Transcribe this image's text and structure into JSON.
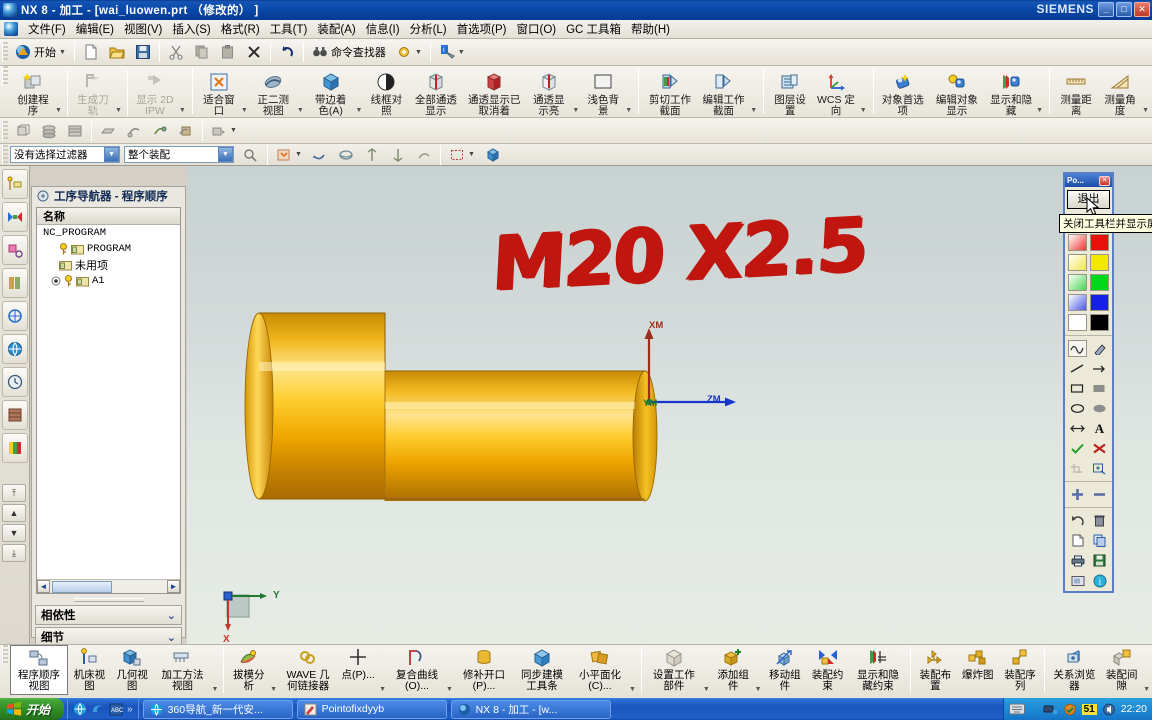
{
  "window": {
    "title": "NX 8 - 加工 - [wai_luowen.prt  （修改的）  ]",
    "brand": "SIEMENS",
    "minimize": "_",
    "maximize": "□",
    "close": "✕"
  },
  "menubar": {
    "items": [
      {
        "label": "文件(F)"
      },
      {
        "label": "编辑(E)"
      },
      {
        "label": "视图(V)"
      },
      {
        "label": "插入(S)"
      },
      {
        "label": "格式(R)"
      },
      {
        "label": "工具(T)"
      },
      {
        "label": "装配(A)"
      },
      {
        "label": "信息(I)"
      },
      {
        "label": "分析(L)"
      },
      {
        "label": "首选项(P)"
      },
      {
        "label": "窗口(O)"
      },
      {
        "label": "GC 工具箱"
      },
      {
        "label": "帮助(H)"
      }
    ],
    "mdi_minimize": "_",
    "mdi_restore": "❐",
    "mdi_close": "✕"
  },
  "standard_toolbar": {
    "start_label": "开始",
    "command_finder_label": "命令查找器",
    "buttons": [
      {
        "name": "new-file",
        "icon": "new-document-icon"
      },
      {
        "name": "open-file",
        "icon": "open-folder-icon"
      },
      {
        "name": "save-file",
        "icon": "save-disk-icon"
      },
      {
        "name": "cut",
        "icon": "scissors-icon"
      },
      {
        "name": "copy",
        "icon": "copy-icon"
      },
      {
        "name": "paste",
        "icon": "paste-icon"
      },
      {
        "name": "delete",
        "icon": "delete-x-icon"
      },
      {
        "name": "undo",
        "icon": "undo-arrow-icon"
      }
    ]
  },
  "ribbon": {
    "groups": [
      {
        "name": "program-group",
        "buttons": [
          {
            "label": "创建程序",
            "icon": "create-program-icon",
            "dim": false,
            "dropdown": true
          },
          {
            "label": "生成刀轨",
            "icon": "generate-toolpath-icon",
            "dim": true,
            "dropdown": true
          },
          {
            "label": "显示 2D IPW",
            "icon": "show-2d-ipw-icon",
            "dim": true,
            "dropdown": true
          }
        ]
      },
      {
        "name": "view-group",
        "buttons": [
          {
            "label": "适合窗口",
            "icon": "fit-window-icon",
            "dim": false,
            "dropdown": true
          },
          {
            "label": "正二测视图",
            "icon": "trimetric-view-icon",
            "dim": false,
            "dropdown": true
          },
          {
            "label": "带边着色(A)",
            "icon": "shaded-edges-icon",
            "dim": false,
            "dropdown": true
          },
          {
            "label": "线框对照",
            "icon": "wireframe-contrast-icon",
            "dim": false,
            "dropdown": false
          },
          {
            "label": "全部通透显示",
            "icon": "all-transparent-icon",
            "dim": false,
            "dropdown": false
          },
          {
            "label": "通透显示已取消着",
            "icon": "transparent-unshaded-icon",
            "dim": false,
            "dropdown": false
          },
          {
            "label": "通透显示亮",
            "icon": "transparent-bright-icon",
            "dim": false,
            "dropdown": true
          },
          {
            "label": "浅色背景",
            "icon": "light-background-icon",
            "dim": false,
            "dropdown": true
          }
        ]
      },
      {
        "name": "section-group",
        "buttons": [
          {
            "label": "剪切工作截面",
            "icon": "clip-section-icon",
            "dim": false,
            "dropdown": false
          },
          {
            "label": "编辑工作截面",
            "icon": "edit-section-icon",
            "dim": false,
            "dropdown": true
          }
        ]
      },
      {
        "name": "layer-group",
        "buttons": [
          {
            "label": "图层设置",
            "icon": "layer-settings-icon",
            "dim": false,
            "dropdown": false
          },
          {
            "label": "WCS 定向",
            "icon": "wcs-orient-icon",
            "dim": false,
            "dropdown": true
          }
        ]
      },
      {
        "name": "object-group",
        "buttons": [
          {
            "label": "对象首选项",
            "icon": "object-preferences-icon",
            "dim": false,
            "dropdown": false
          },
          {
            "label": "编辑对象显示",
            "icon": "edit-object-display-icon",
            "dim": false,
            "dropdown": false
          },
          {
            "label": "显示和隐藏",
            "icon": "show-hide-icon",
            "dim": false,
            "dropdown": true
          }
        ]
      },
      {
        "name": "measure-group",
        "buttons": [
          {
            "label": "测量距离",
            "icon": "measure-distance-icon",
            "dim": false,
            "dropdown": false
          },
          {
            "label": "测量角度",
            "icon": "measure-angle-icon",
            "dim": false,
            "dropdown": true
          }
        ]
      }
    ]
  },
  "solid_toolbar": {
    "buttons": [
      {
        "name": "extrude",
        "icon": "extrude-icon"
      },
      {
        "name": "shell",
        "icon": "shell-icon"
      },
      {
        "name": "boolean",
        "icon": "boolean-icon"
      },
      {
        "name": "chamfer",
        "icon": "chamfer-icon"
      },
      {
        "name": "trim",
        "icon": "trim-icon"
      },
      {
        "name": "pattern",
        "icon": "pattern-icon"
      },
      {
        "name": "offset",
        "icon": "offset-icon"
      },
      {
        "name": "more-solids",
        "icon": "more-solids-icon"
      }
    ]
  },
  "selection_bar": {
    "filter_value": "没有选择过滤器",
    "scope_value": "整个装配",
    "buttons": [
      {
        "name": "select-general",
        "icon": "select-general-icon"
      },
      {
        "name": "select-face",
        "icon": "select-face-icon"
      },
      {
        "name": "select-body",
        "icon": "select-body-icon"
      },
      {
        "name": "select-edge",
        "icon": "select-edge-icon"
      },
      {
        "name": "select-curve",
        "icon": "select-curve-icon"
      },
      {
        "name": "select-point",
        "icon": "select-point-icon"
      },
      {
        "name": "rectangle-select",
        "icon": "rectangle-select-icon"
      },
      {
        "name": "solid-select",
        "icon": "solid-cube-icon"
      }
    ]
  },
  "resource_bar": {
    "items": [
      {
        "name": "operation-navigator",
        "icon": "operation-navigator-icon"
      },
      {
        "name": "assembly-navigator",
        "icon": "assembly-navigator-icon"
      },
      {
        "name": "part-navigator",
        "icon": "part-navigator-icon"
      },
      {
        "name": "reuse-library",
        "icon": "reuse-library-icon"
      },
      {
        "name": "hd3d-tools",
        "icon": "hd3d-tools-icon"
      },
      {
        "name": "web-browser",
        "icon": "web-browser-icon"
      },
      {
        "name": "history",
        "icon": "history-clock-icon"
      },
      {
        "name": "system-materials",
        "icon": "materials-icon"
      },
      {
        "name": "roles",
        "icon": "roles-palette-icon"
      }
    ]
  },
  "navigator": {
    "title": "工序导航器 - 程序顺序",
    "column_header": "名称",
    "tree": [
      {
        "label": "NC_PROGRAM",
        "level": 0,
        "icon": "root-node-icon"
      },
      {
        "label": "PROGRAM",
        "level": 1,
        "icon": "program-folder-icon"
      },
      {
        "label": "未用项",
        "level": 1,
        "icon": "unused-folder-icon"
      },
      {
        "label": "A1",
        "level": 1,
        "icon": "program-folder-icon"
      }
    ],
    "scroll_left": "◄",
    "scroll_right": "►",
    "sections": [
      {
        "label": "相依性",
        "chevron": "⌄"
      },
      {
        "label": "细节",
        "chevron": "⌄"
      }
    ]
  },
  "graphics": {
    "annotation_text": "M20 X2.5",
    "annotation_color": "#c0160f",
    "wcs": {
      "x_label": "XM",
      "y_label": "YM",
      "z_label": "ZM",
      "x_color": "#b03020",
      "y_color": "#2f8f3f",
      "z_color": "#1636c8"
    },
    "view_triad": {
      "x_label": "X",
      "y_label": "Y",
      "x_color": "#c0392b",
      "y_color": "#27ae60"
    },
    "model_color": "#f0a800"
  },
  "float_toolbar": {
    "title": "Po...",
    "close": "✕",
    "exit_label": "退出",
    "tooltip": "关闭工具栏并显示屏幕",
    "pen_sizes": [
      "small-dot",
      "large-dot"
    ],
    "colors": [
      {
        "name": "red-gradient",
        "hex": "#e8392e"
      },
      {
        "name": "red-solid",
        "hex": "#e8100b"
      },
      {
        "name": "yellow-gradient",
        "hex": "#f2e64a"
      },
      {
        "name": "yellow-solid",
        "hex": "#f5e800"
      },
      {
        "name": "green-gradient",
        "hex": "#4ad452"
      },
      {
        "name": "green-solid",
        "hex": "#00d81a"
      },
      {
        "name": "blue-gradient",
        "hex": "#4a58e0"
      },
      {
        "name": "blue-solid",
        "hex": "#1420e8"
      },
      {
        "name": "white",
        "hex": "#ffffff"
      },
      {
        "name": "black",
        "hex": "#000000"
      }
    ],
    "tools": [
      {
        "name": "freehand-pen-icon",
        "glyph": "∿"
      },
      {
        "name": "eraser-icon",
        "glyph": "✐"
      },
      {
        "name": "line-icon",
        "glyph": "╱"
      },
      {
        "name": "arrow-icon",
        "glyph": "→"
      },
      {
        "name": "rectangle-outline-icon",
        "glyph": "▭"
      },
      {
        "name": "rectangle-filled-icon",
        "glyph": "▬"
      },
      {
        "name": "ellipse-outline-icon",
        "glyph": "◯"
      },
      {
        "name": "ellipse-filled-icon",
        "glyph": "⬭"
      },
      {
        "name": "double-arrow-icon",
        "glyph": "↔"
      },
      {
        "name": "text-tool-icon",
        "glyph": "A"
      },
      {
        "name": "check-mark-icon",
        "glyph": "✓"
      },
      {
        "name": "cross-mark-icon",
        "glyph": "✗"
      },
      {
        "name": "crop-icon",
        "glyph": "⌗"
      },
      {
        "name": "zoom-icon",
        "glyph": "⊕"
      },
      {
        "name": "zoom-in-icon",
        "glyph": "✚"
      },
      {
        "name": "zoom-out-icon",
        "glyph": "—"
      },
      {
        "name": "undo-icon",
        "glyph": "↺"
      },
      {
        "name": "trash-icon",
        "glyph": "🗑"
      },
      {
        "name": "new-page-icon",
        "glyph": "🗋"
      },
      {
        "name": "copy-icon",
        "glyph": "⧉"
      },
      {
        "name": "print-icon",
        "glyph": "🖶"
      },
      {
        "name": "save-icon",
        "glyph": "💾"
      },
      {
        "name": "screenshot-icon",
        "glyph": "🖼"
      },
      {
        "name": "info-icon",
        "glyph": "i"
      }
    ]
  },
  "bottom_bar": {
    "buttons": [
      {
        "label": "程序顺序视图",
        "icon": "program-order-view-icon",
        "active": true,
        "dropdown": false
      },
      {
        "label": "机床视图",
        "icon": "machine-tool-view-icon",
        "active": false,
        "dropdown": false
      },
      {
        "label": "几何视图",
        "icon": "geometry-view-icon",
        "active": false,
        "dropdown": false
      },
      {
        "label": "加工方法视图",
        "icon": "machining-method-view-icon",
        "active": false,
        "dropdown": true
      },
      {
        "label": "拔模分析",
        "icon": "draft-analysis-icon",
        "active": false,
        "dropdown": true
      },
      {
        "label": "WAVE 几何链接器",
        "icon": "wave-geometry-linker-icon",
        "active": false,
        "dropdown": false
      },
      {
        "label": "点(P)...",
        "icon": "point-icon",
        "active": false,
        "dropdown": true
      },
      {
        "label": "复合曲线(O)...",
        "icon": "composite-curve-icon",
        "active": false,
        "dropdown": true
      },
      {
        "label": "修补开口(P)...",
        "icon": "patch-opening-icon",
        "active": false,
        "dropdown": false
      },
      {
        "label": "同步建模工具条",
        "icon": "synchronous-modeling-icon",
        "active": false,
        "dropdown": false
      },
      {
        "label": "小平面化(C)...",
        "icon": "faceting-icon",
        "active": false,
        "dropdown": true
      },
      {
        "label": "设置工作部件",
        "icon": "set-work-part-icon",
        "active": false,
        "dropdown": true
      },
      {
        "label": "添加组件",
        "icon": "add-component-icon",
        "active": false,
        "dropdown": true
      },
      {
        "label": "移动组件",
        "icon": "move-component-icon",
        "active": false,
        "dropdown": false
      },
      {
        "label": "装配约束",
        "icon": "assembly-constraint-icon",
        "active": false,
        "dropdown": false
      },
      {
        "label": "显示和隐藏约束",
        "icon": "show-hide-constraints-icon",
        "active": false,
        "dropdown": false
      },
      {
        "label": "装配布置",
        "icon": "assembly-arrangement-icon",
        "active": false,
        "dropdown": false
      },
      {
        "label": "爆炸图",
        "icon": "exploded-view-icon",
        "active": false,
        "dropdown": false
      },
      {
        "label": "装配序列",
        "icon": "assembly-sequence-icon",
        "active": false,
        "dropdown": false
      },
      {
        "label": "关系浏览器",
        "icon": "relation-browser-icon",
        "active": false,
        "dropdown": false
      },
      {
        "label": "装配间隙",
        "icon": "assembly-clearance-icon",
        "active": false,
        "dropdown": true
      }
    ]
  },
  "taskbar": {
    "start_label": "开始",
    "quicklaunch": [
      {
        "name": "ie-browser-icon"
      },
      {
        "name": "edge-icon"
      },
      {
        "name": "media-icon"
      },
      {
        "name": "more-chevron"
      }
    ],
    "tasks": [
      {
        "label": "360导航_新一代安...",
        "icon": "ie-browser-icon"
      },
      {
        "label": "Pointofixdyyb",
        "icon": "pointofix-icon"
      },
      {
        "label": "NX 8 - 加工 - [w...",
        "icon": "nx-icon"
      }
    ],
    "tray": {
      "badge": "51",
      "time": "22:20",
      "icons": [
        "network-icon",
        "shield-icon",
        "volume-icon"
      ]
    }
  }
}
